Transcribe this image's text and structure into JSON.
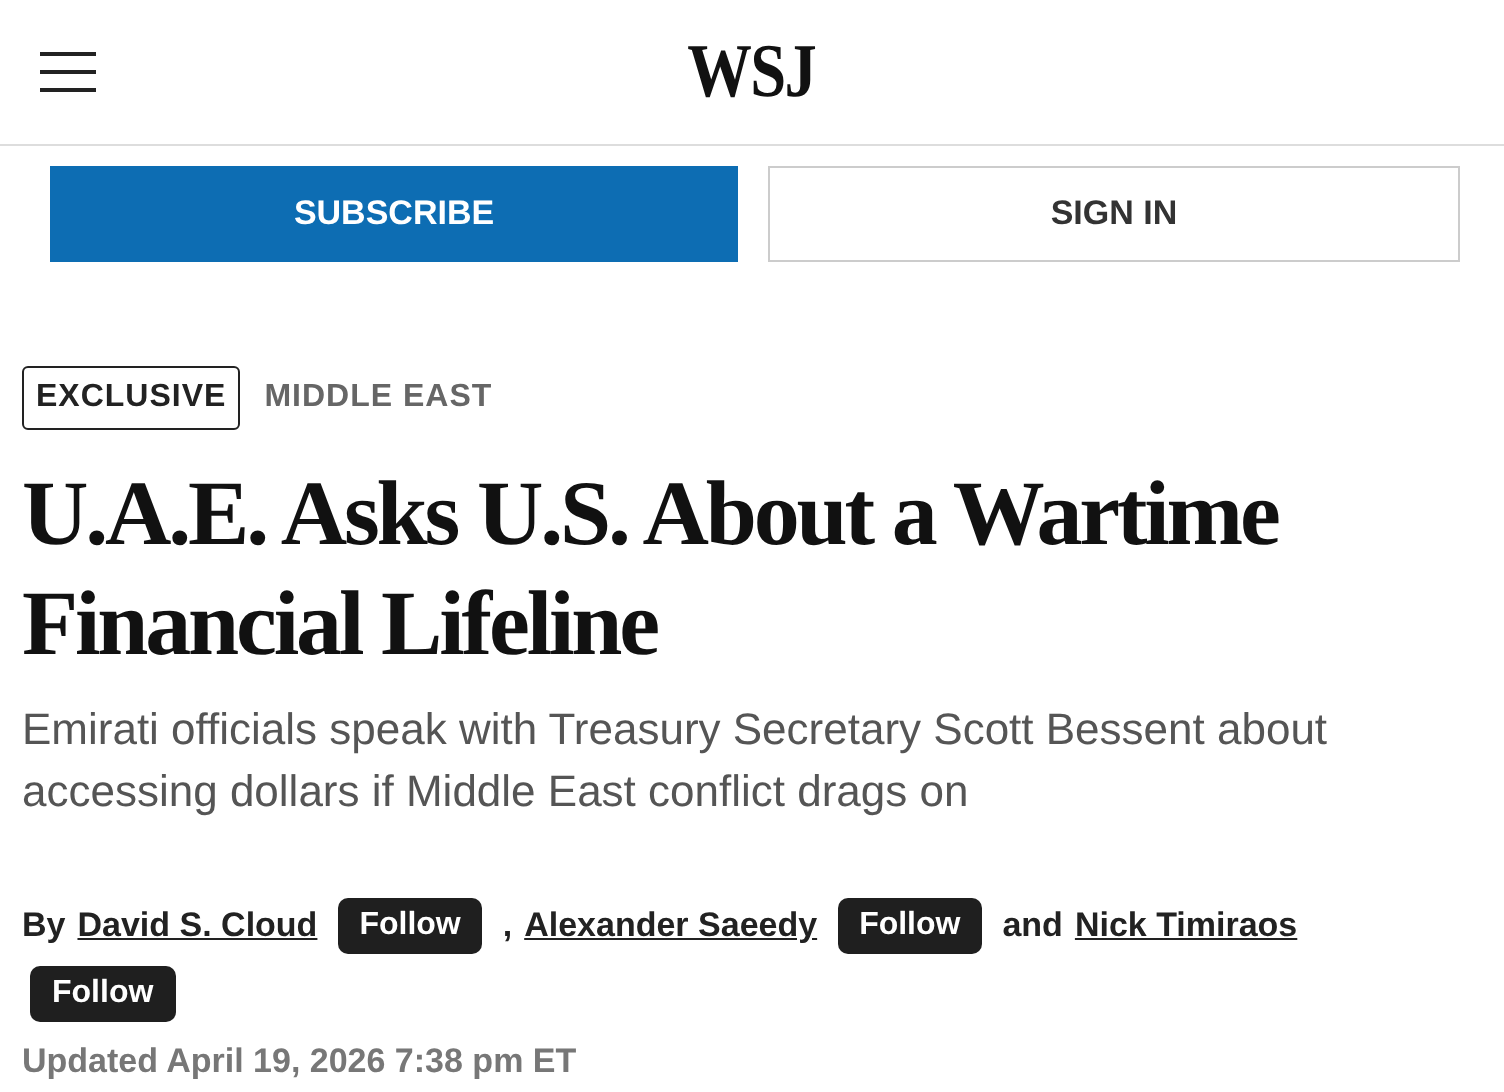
{
  "header": {
    "logo": "WSJ"
  },
  "actions": [
    {
      "label": "SUBSCRIBE",
      "kind": "primary"
    },
    {
      "label": "SIGN IN",
      "kind": "secondary"
    }
  ],
  "article": {
    "tag": "EXCLUSIVE",
    "section": "MIDDLE EAST",
    "headline": "U.A.E. Asks U.S. About a Wartime Financial Lifeline",
    "dek": "Emirati officials speak with Treasury Secretary Scott Bessent about accessing dollars if Middle East conflict drags on",
    "byline": {
      "prefix": "By",
      "authors": [
        {
          "name": "David S. Cloud",
          "follow": "Follow",
          "joiner": ","
        },
        {
          "name": "Alexander Saeedy",
          "follow": "Follow",
          "joiner": "and"
        },
        {
          "name": "Nick Timiraos",
          "follow": "Follow"
        }
      ]
    },
    "updated": "Updated April 19, 2026 7:38 pm ET"
  }
}
